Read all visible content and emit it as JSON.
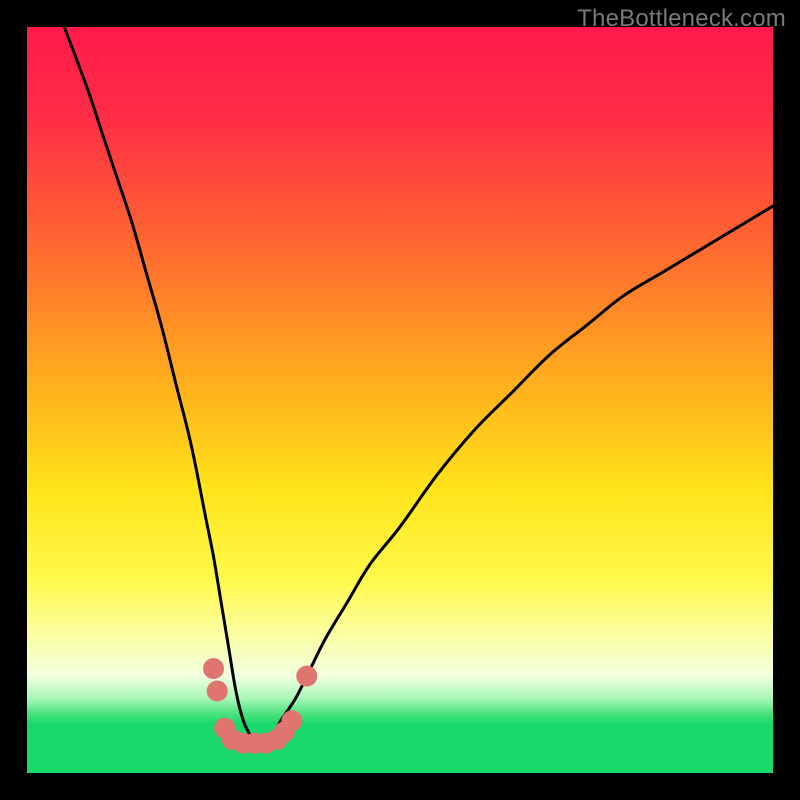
{
  "watermark": "TheBottleneck.com",
  "colors": {
    "frame": "#000000",
    "curve": "#000000",
    "marker": "#e0746f",
    "gradient_stops": [
      {
        "offset": 0.0,
        "color": "#ff1a4b"
      },
      {
        "offset": 0.12,
        "color": "#ff2d46"
      },
      {
        "offset": 0.3,
        "color": "#ff6a2f"
      },
      {
        "offset": 0.48,
        "color": "#ffb01d"
      },
      {
        "offset": 0.62,
        "color": "#ffe41a"
      },
      {
        "offset": 0.74,
        "color": "#fff94a"
      },
      {
        "offset": 0.82,
        "color": "#fbffa8"
      },
      {
        "offset": 0.87,
        "color": "#f0ffe0"
      },
      {
        "offset": 0.9,
        "color": "#a8f8b8"
      },
      {
        "offset": 0.92,
        "color": "#4de27f"
      },
      {
        "offset": 0.935,
        "color": "#18d96a"
      },
      {
        "offset": 1.0,
        "color": "#18d96a"
      }
    ]
  },
  "chart_data": {
    "type": "line",
    "title": "",
    "xlabel": "",
    "ylabel": "",
    "xlim": [
      0,
      100
    ],
    "ylim": [
      0,
      100
    ],
    "series": [
      {
        "name": "bottleneck-curve",
        "x": [
          5,
          8,
          10,
          12,
          14,
          16,
          18,
          20,
          22,
          24,
          25,
          26,
          27,
          28,
          29,
          30,
          31,
          32,
          33,
          34,
          36,
          38,
          40,
          43,
          46,
          50,
          55,
          60,
          65,
          70,
          75,
          80,
          85,
          90,
          95,
          100
        ],
        "y": [
          100,
          92,
          86,
          80,
          74,
          67,
          60,
          52,
          44,
          34,
          29,
          23,
          17,
          11,
          7,
          5,
          4,
          4,
          5,
          7,
          10,
          14,
          18,
          23,
          28,
          33,
          40,
          46,
          51,
          56,
          60,
          64,
          67,
          70,
          73,
          76
        ]
      }
    ],
    "markers": {
      "name": "highlight-points",
      "points": [
        {
          "x": 25.0,
          "y": 14
        },
        {
          "x": 25.5,
          "y": 11
        },
        {
          "x": 26.5,
          "y": 6
        },
        {
          "x": 27.5,
          "y": 4.5
        },
        {
          "x": 29.0,
          "y": 4
        },
        {
          "x": 30.5,
          "y": 4
        },
        {
          "x": 32.0,
          "y": 4
        },
        {
          "x": 33.5,
          "y": 4.5
        },
        {
          "x": 34.5,
          "y": 5.5
        },
        {
          "x": 35.5,
          "y": 7
        },
        {
          "x": 37.5,
          "y": 13
        }
      ]
    }
  }
}
